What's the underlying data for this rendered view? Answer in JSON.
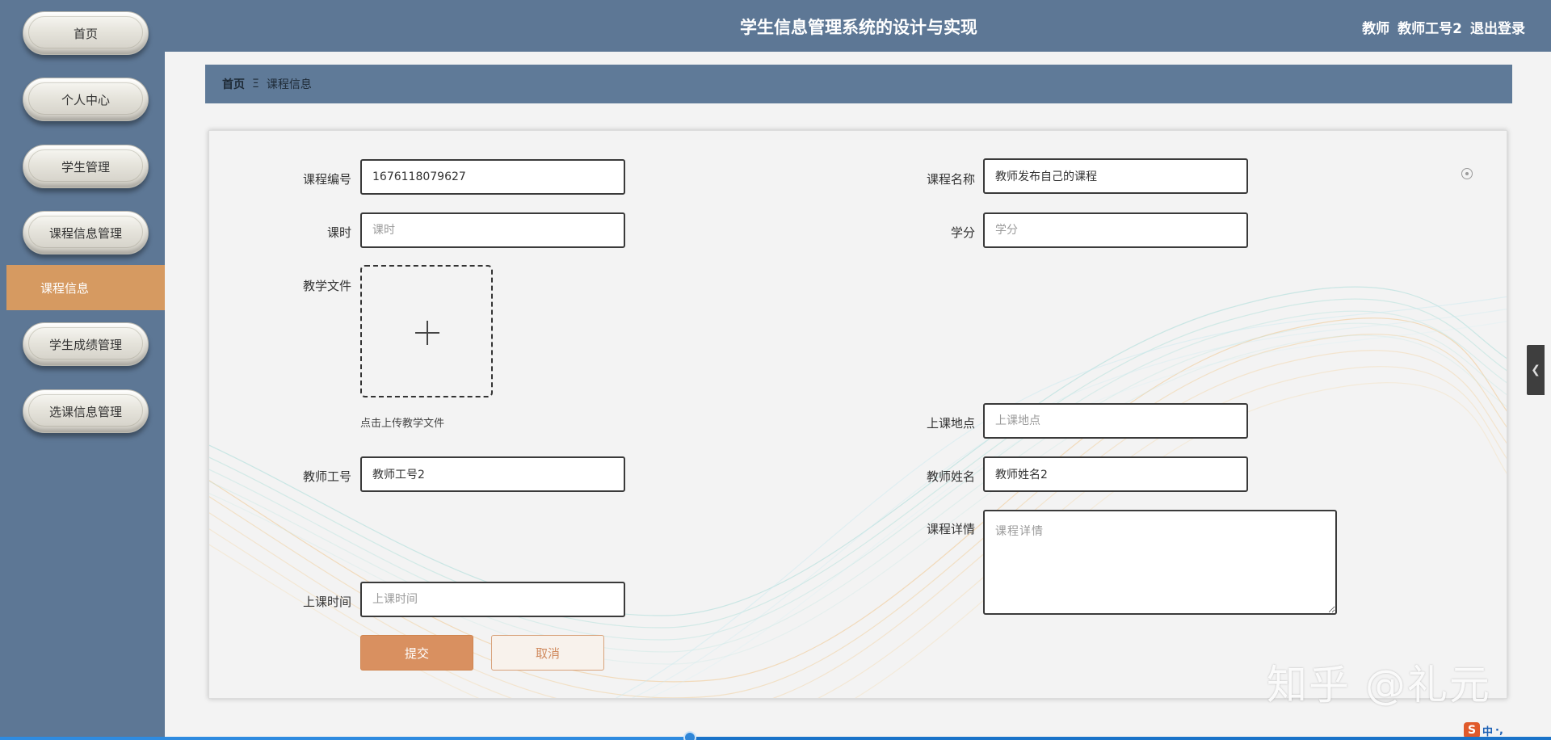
{
  "app": {
    "title": "学生信息管理系统的设计与实现"
  },
  "header": {
    "role": "教师",
    "username": "教师工号2",
    "logout_label": "退出登录"
  },
  "sidebar": {
    "items": [
      {
        "label": "首页"
      },
      {
        "label": "个人中心"
      },
      {
        "label": "学生管理"
      },
      {
        "label": "课程信息管理"
      },
      {
        "label": "学生成绩管理"
      },
      {
        "label": "选课信息管理"
      }
    ],
    "active_sub_item": {
      "label": "课程信息"
    }
  },
  "breadcrumb": {
    "home": "首页",
    "separator": "Ξ",
    "current": "课程信息"
  },
  "form": {
    "course_no": {
      "label": "课程编号",
      "value": "1676118079627",
      "placeholder": "课程编号"
    },
    "course_name": {
      "label": "课程名称",
      "value": "教师发布自己的课程",
      "placeholder": "课程名称"
    },
    "hours": {
      "label": "课时",
      "value": "",
      "placeholder": "课时"
    },
    "credits": {
      "label": "学分",
      "value": "",
      "placeholder": "学分"
    },
    "teaching_file": {
      "label": "教学文件",
      "hint": "点击上传教学文件"
    },
    "location": {
      "label": "上课地点",
      "value": "",
      "placeholder": "上课地点"
    },
    "teacher_id": {
      "label": "教师工号",
      "value": "教师工号2",
      "placeholder": "教师工号"
    },
    "teacher_name": {
      "label": "教师姓名",
      "value": "教师姓名2",
      "placeholder": "教师姓名"
    },
    "details": {
      "label": "课程详情",
      "value": "",
      "placeholder": "课程详情"
    },
    "class_time": {
      "label": "上课时间",
      "value": "",
      "placeholder": "上课时间"
    },
    "submit_label": "提交",
    "cancel_label": "取消"
  },
  "watermark": "知乎 @礼元",
  "ime": {
    "mode": "中",
    "punct": "·,"
  },
  "progress": {
    "fraction": 0.445
  },
  "colors": {
    "sidebar_bg": "#5d7795",
    "header_bg": "#5d7795",
    "accent_orange": "#d69a61",
    "submit_bg": "#d99060"
  }
}
